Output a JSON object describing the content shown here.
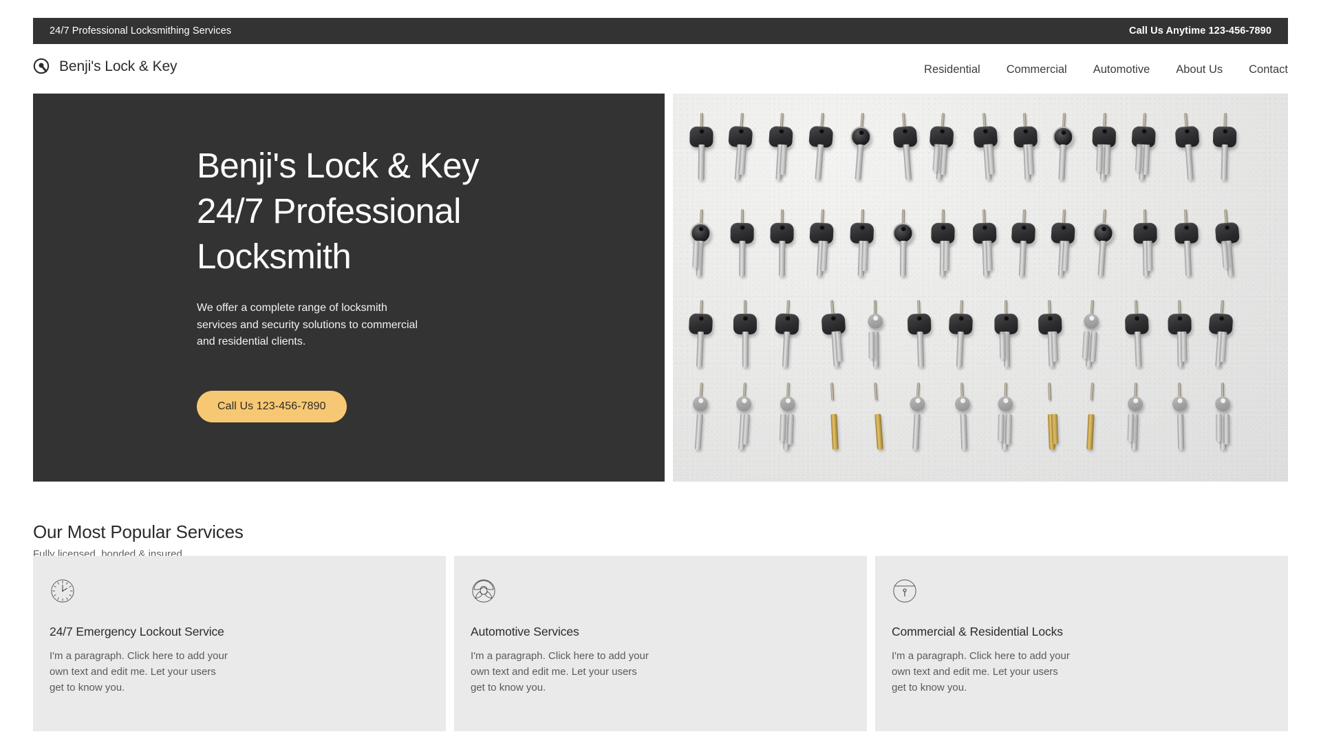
{
  "topbar": {
    "tagline": "24/7 Professional Locksmithing Services",
    "phone_label": "Call Us Anytime 123-456-7890"
  },
  "header": {
    "logo_icon": "keyhole-lock-icon",
    "brand_name": "Benji's Lock & Key",
    "nav": [
      {
        "label": "Residential"
      },
      {
        "label": "Commercial"
      },
      {
        "label": "Automotive"
      },
      {
        "label": "About Us"
      },
      {
        "label": "Contact"
      }
    ]
  },
  "hero": {
    "title": "Benji's Lock & Key\n24/7 Professional\nLocksmith",
    "subtitle": "We offer a complete range of locksmith\nservices and security solutions to commercial\nand residential clients.",
    "cta_label": "Call Us 123-456-7890",
    "image_alt": "Rows of car keys and key fobs hanging on pegs against a light textured wall"
  },
  "services": {
    "title": "Our Most Popular Services",
    "subtitle": "Fully licensed, bonded & insured",
    "cards": [
      {
        "icon": "clock-icon",
        "title": "24/7 Emergency Lockout Service",
        "body": "I'm a paragraph. Click here to add your\nown text and edit me. Let your users\nget to know you."
      },
      {
        "icon": "steering-wheel-icon",
        "title": "Automotive Services",
        "body": "I'm a paragraph. Click here to add your\nown text and edit me. Let your users\nget to know you."
      },
      {
        "icon": "padlock-keyhole-icon",
        "title": "Commercial & Residential Locks",
        "body": "I'm a paragraph. Click here to add your\nown text and edit me. Let your users\nget to know you."
      }
    ]
  },
  "colors": {
    "dark": "#333333",
    "accent": "#f7c873",
    "card_bg": "#eaeaea",
    "page_bg": "#ffffff"
  }
}
